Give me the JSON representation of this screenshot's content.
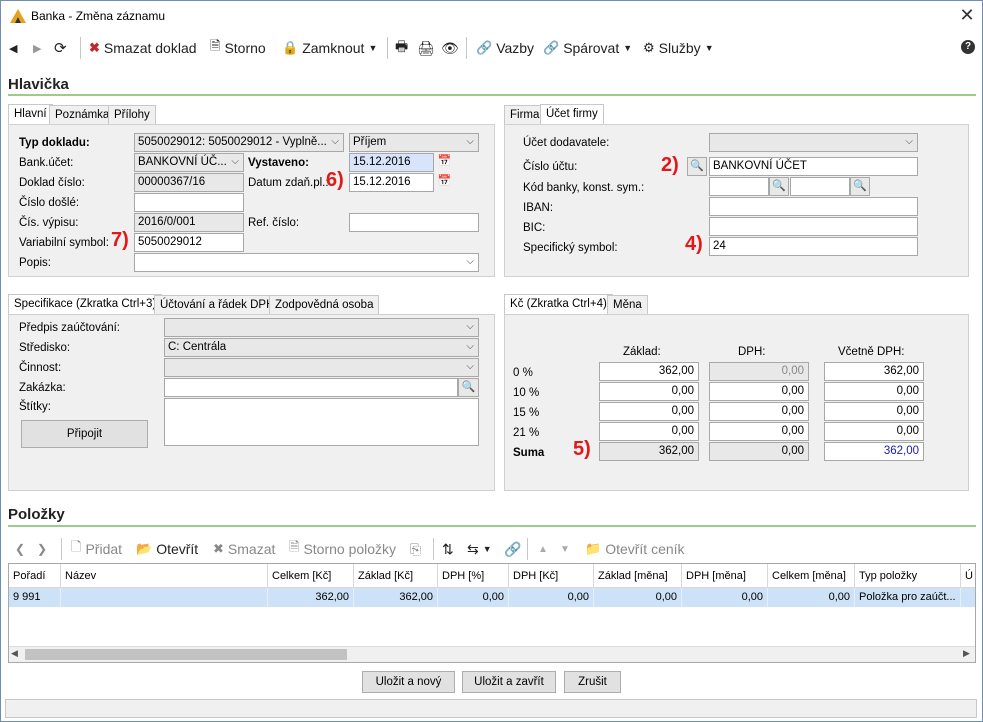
{
  "window": {
    "title": "Banka - Změna záznamu",
    "close": "✕"
  },
  "toolbar": {
    "delete": "Smazat doklad",
    "cancel": "Storno",
    "lock": "Zamknout",
    "links": "Vazby",
    "pair": "Spárovat",
    "services": "Služby"
  },
  "header_section": "Hlavička",
  "left_tabs": [
    "Hlavní",
    "Poznámka",
    "Přílohy"
  ],
  "main": {
    "doc_type_label": "Typ dokladu:",
    "doc_type_value": "5050029012: 5050029012 - Vyplně...",
    "direction_value": "Příjem",
    "bank_account_label": "Bank.účet:",
    "bank_account_value": "BANKOVNÍ ÚČ...",
    "issued_label": "Vystaveno:",
    "issued_value": "15.12.2016",
    "doc_no_label": "Doklad číslo:",
    "doc_no_value": "00000367/16",
    "tax_date_label": "Datum zdaň.pl.:",
    "tax_date_value": "15.12.2016",
    "incoming_no_label": "Číslo došlé:",
    "incoming_no_value": "",
    "statement_no_label": "Čís. výpisu:",
    "statement_no_value": "2016/0/001",
    "ref_no_label": "Ref. číslo:",
    "ref_no_value": "",
    "variable_symbol_label": "Variabilní symbol:",
    "variable_symbol_value": "5050029012",
    "description_label": "Popis:",
    "description_value": ""
  },
  "right_tabs": [
    "Firma",
    "Účet firmy"
  ],
  "firm_account": {
    "supplier_account_label": "Účet dodavatele:",
    "account_no_label": "Číslo účtu:",
    "account_no_value": "BANKOVNÍ ÚČET",
    "bank_code_label": "Kód banky, konst. sym.:",
    "iban_label": "IBAN:",
    "bic_label": "BIC:",
    "specific_symbol_label": "Specifický symbol:",
    "specific_symbol_value": "24"
  },
  "spec_tabs": [
    "Specifikace (Zkratka Ctrl+3)",
    "Účtování a řádek DPH",
    "Zodpovědná osoba"
  ],
  "spec": {
    "posting_label": "Předpis zaúčtování:",
    "center_label": "Středisko:",
    "center_value": "C: Centrála",
    "activity_label": "Činnost:",
    "order_label": "Zakázka:",
    "tags_label": "Štítky:",
    "attach_button": "Připojit"
  },
  "vat_tabs": [
    "Kč (Zkratka Ctrl+4)",
    "Měna"
  ],
  "vat": {
    "col_base": "Základ:",
    "col_vat": "DPH:",
    "col_total": "Včetně DPH:",
    "rows": [
      {
        "label": "0 %",
        "base": "362,00",
        "vat": "0,00",
        "total": "362,00"
      },
      {
        "label": "10 %",
        "base": "0,00",
        "vat": "0,00",
        "total": "0,00"
      },
      {
        "label": "15 %",
        "base": "0,00",
        "vat": "0,00",
        "total": "0,00"
      },
      {
        "label": "21 %",
        "base": "0,00",
        "vat": "0,00",
        "total": "0,00"
      },
      {
        "label": "Suma",
        "base": "362,00",
        "vat": "0,00",
        "total": "362,00"
      }
    ]
  },
  "annotations": [
    "2)",
    "4)",
    "5)",
    "6)",
    "7)"
  ],
  "items_section": "Položky",
  "items_toolbar": {
    "add": "Přidat",
    "open": "Otevřít",
    "delete": "Smazat",
    "cancel_items": "Storno položky",
    "open_pricelist": "Otevřít ceník"
  },
  "items_table": {
    "columns": [
      "Pořadí",
      "Název",
      "Celkem [Kč]",
      "Základ [Kč]",
      "DPH [%]",
      "DPH [Kč]",
      "Základ [měna]",
      "DPH [měna]",
      "Celkem [měna]",
      "Typ položky",
      "Ú"
    ],
    "rows": [
      [
        "9 991",
        "",
        "362,00",
        "362,00",
        "0,00",
        "0,00",
        "0,00",
        "0,00",
        "0,00",
        "Položka pro zaúčt...",
        ""
      ]
    ]
  },
  "buttons": {
    "save_new": "Uložit a nový",
    "save_close": "Uložit a zavřít",
    "cancel": "Zrušit"
  }
}
